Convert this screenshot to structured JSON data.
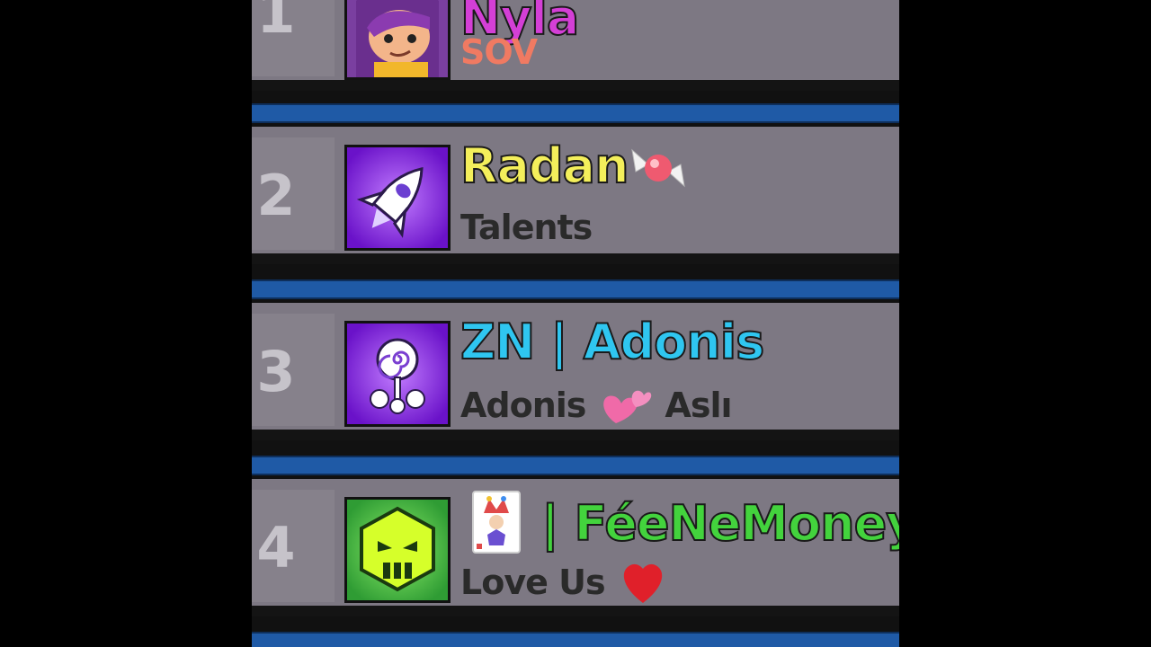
{
  "rows": [
    {
      "rank": "1",
      "name": "Nyla",
      "subtitle": "SOV",
      "name_color": "#d43fd6",
      "sub_color": "#f07a62",
      "icon": "shelly-portrait-icon"
    },
    {
      "rank": "2",
      "name": "Radan",
      "subtitle": "Talents",
      "name_color": "#f4ef5b",
      "sub_color": "#2a2a2a",
      "icon": "rocket-icon"
    },
    {
      "rank": "3",
      "name": "ZN | Adonis",
      "subtitle_a": "Adonis",
      "subtitle_b": "Aslı",
      "name_color": "#2fc6f0",
      "sub_color": "#2a2a2a",
      "icon": "lollipop-icon"
    },
    {
      "rank": "4",
      "name": "| FéeNeMoney",
      "subtitle": "Love Us",
      "name_color": "#43d33d",
      "sub_color": "#2a2a2a",
      "icon": "skull-hexagon-icon"
    }
  ],
  "colors": {
    "row_bg": "#7d7883",
    "bar_blue": "#1f5aa6"
  }
}
